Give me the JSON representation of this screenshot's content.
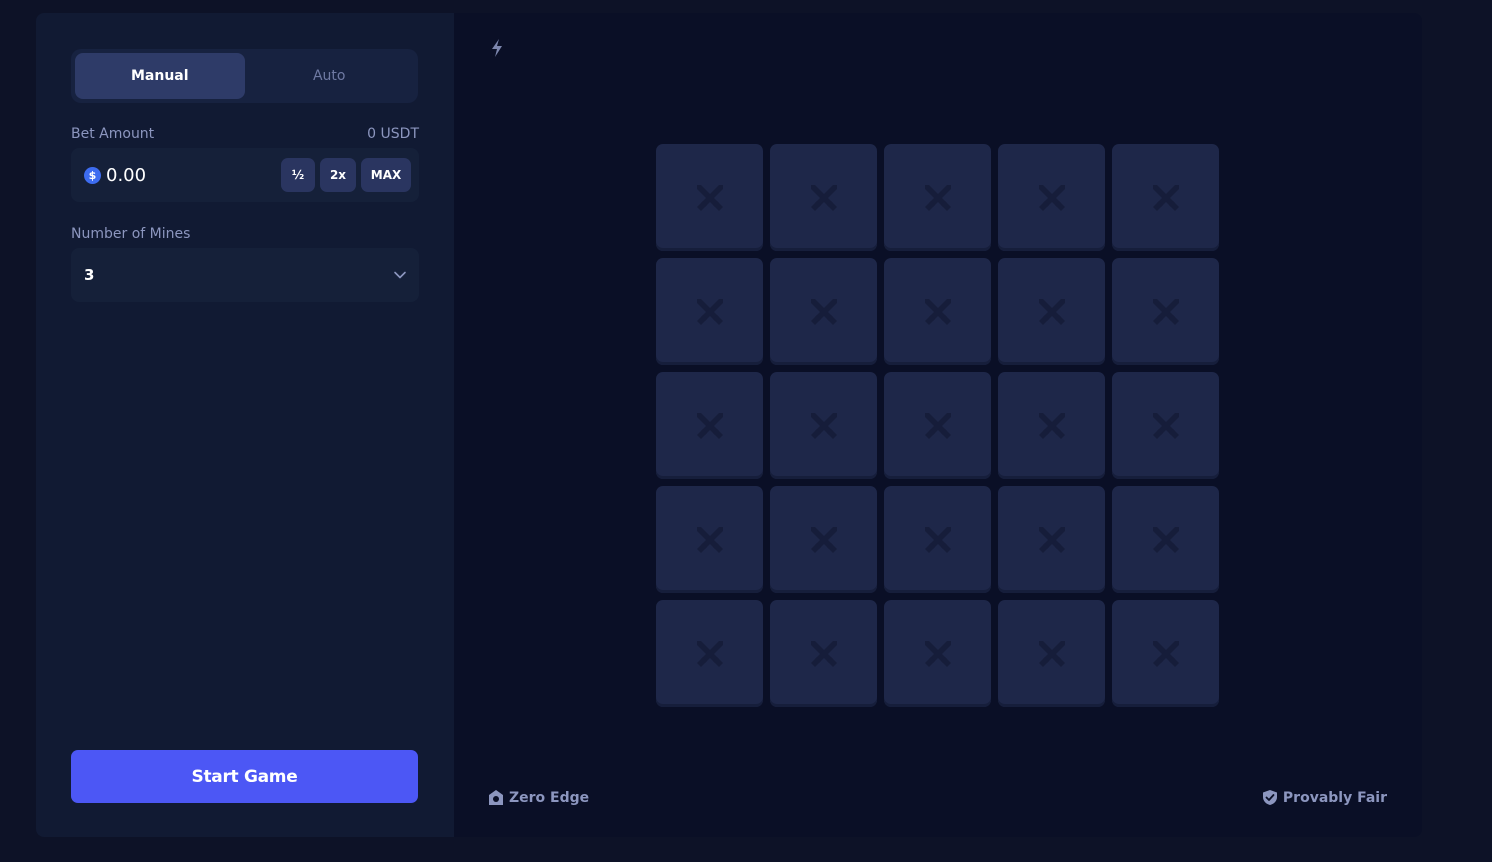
{
  "tabs": [
    {
      "label": "Manual",
      "active": true
    },
    {
      "label": "Auto",
      "active": false
    }
  ],
  "bet": {
    "label": "Bet Amount",
    "balance": "0 USDT",
    "currency_symbol": "$",
    "value": "0.00",
    "half_label": "½",
    "double_label": "2x",
    "max_label": "MAX"
  },
  "mines": {
    "label": "Number of Mines",
    "selected": "3"
  },
  "start_label": "Start Game",
  "board": {
    "rows": 5,
    "cols": 5,
    "tile_icon": "crossed-swords-icon"
  },
  "footer": {
    "zero_edge": "Zero Edge",
    "provably_fair": "Provably Fair"
  },
  "colors": {
    "accent": "#4c57f5",
    "sidebar_bg": "#111a33",
    "game_bg": "#0a0f26",
    "tile_bg": "#1e2749"
  }
}
